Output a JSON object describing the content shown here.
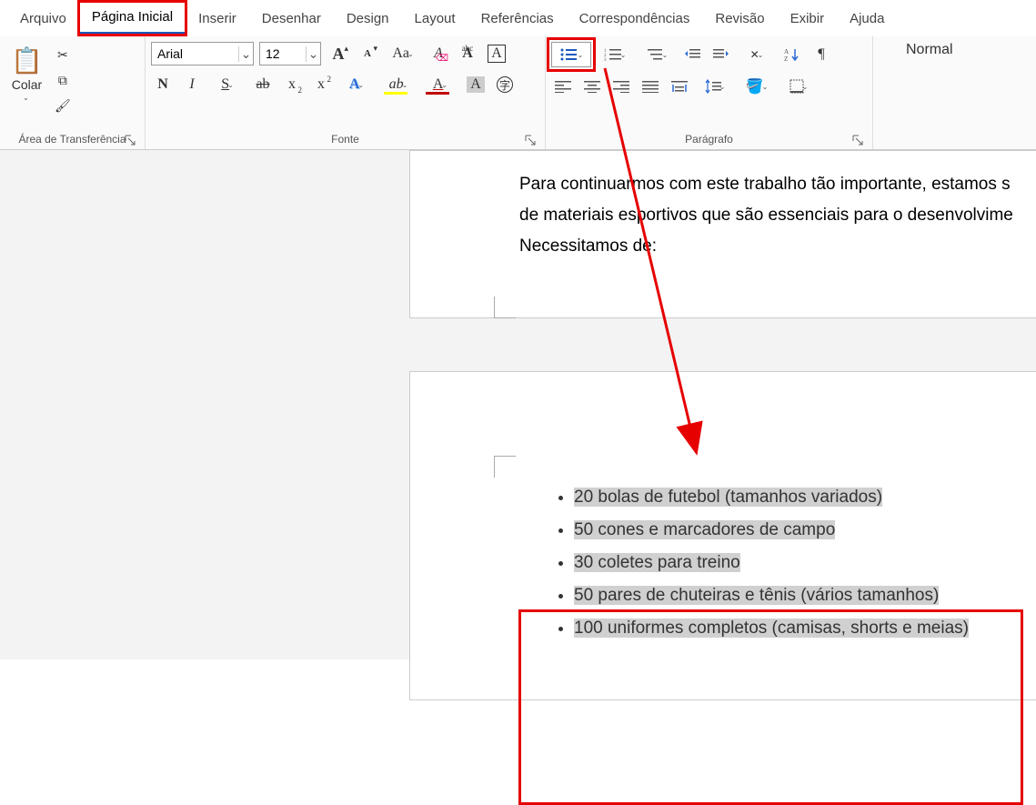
{
  "tabs": {
    "arquivo": "Arquivo",
    "pagina_inicial": "Página Inicial",
    "inserir": "Inserir",
    "desenhar": "Desenhar",
    "design": "Design",
    "layout": "Layout",
    "referencias": "Referências",
    "correspondencias": "Correspondências",
    "revisao": "Revisão",
    "exibir": "Exibir",
    "ajuda": "Ajuda"
  },
  "clipboard": {
    "paste_label": "Colar",
    "group_label": "Área de Transferência"
  },
  "font": {
    "name": "Arial",
    "size": "12",
    "group_label": "Fonte"
  },
  "paragraph": {
    "group_label": "Parágrafo"
  },
  "styles": {
    "normal": "Normal"
  },
  "document": {
    "intro_line1": "Para continuarmos com este trabalho tão importante, estamos s",
    "intro_line2": "de materiais esportivos que são essenciais para o desenvolvime",
    "intro_line3": "Necessitamos de:",
    "list": [
      "20 bolas de futebol (tamanhos variados)",
      "50 cones e marcadores de campo",
      "30 coletes para treino",
      "50 pares de chuteiras e tênis (vários tamanhos)",
      "100 uniformes completos (camisas, shorts e meias)"
    ]
  }
}
